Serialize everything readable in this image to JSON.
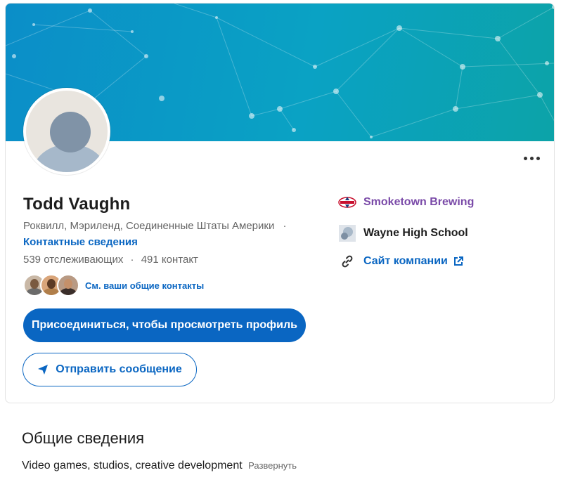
{
  "profile": {
    "name": "Todd Vaughn",
    "location": "Роквилл, Мэриленд, Соединенные Штаты Америки",
    "location_sep": "·",
    "contact_info": "Контактные сведения",
    "followers": "539 отслеживающих",
    "stats_sep": "·",
    "connections": "491 контакт",
    "mutual_link": "См. ваши общие контакты"
  },
  "actions": {
    "join_label": "Присоединиться, чтобы просмотреть профиль",
    "message_label": "Отправить сообщение"
  },
  "right_panel": {
    "company": "Smoketown Brewing",
    "school": "Wayne High School",
    "website": "Сайт компании"
  },
  "about": {
    "title": "Общие сведения",
    "text": "Video games, studios, creative development",
    "expand": "Развернуть"
  },
  "colors": {
    "accent": "#0a66c2",
    "company_link": "#7a4aa8",
    "banner": "#0a9cc6"
  },
  "icons": {
    "more": "more-horizontal-icon",
    "send": "send-icon",
    "link": "link-icon",
    "external": "external-link-icon"
  }
}
